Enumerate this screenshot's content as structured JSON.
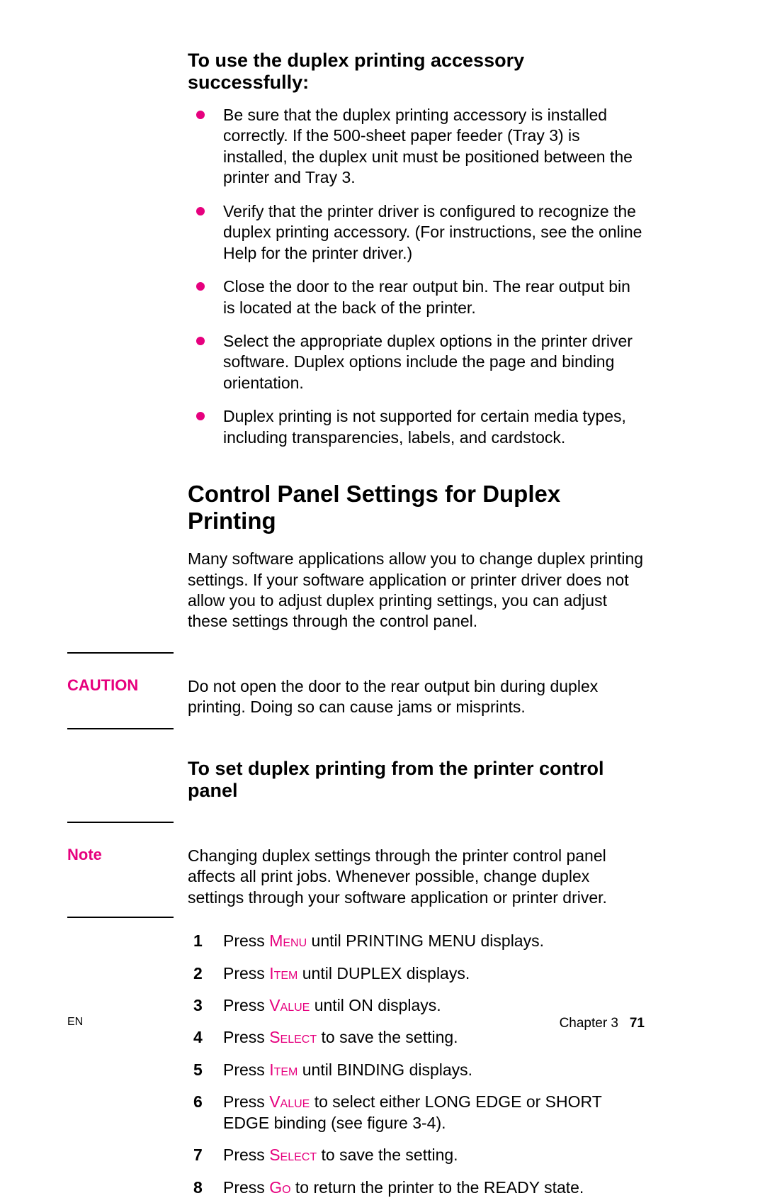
{
  "section1": {
    "heading": "To use the duplex printing accessory successfully:",
    "bullets": [
      "Be sure that the duplex printing accessory is installed correctly. If the 500-sheet paper feeder (Tray 3) is installed, the duplex unit must be positioned between the printer and Tray 3.",
      "Verify that the printer driver is configured to recognize the duplex printing accessory. (For instructions, see the online Help for the printer driver.)",
      "Close the door to the rear output bin. The rear output bin is located at the back of the printer.",
      "Select the appropriate duplex options in the printer driver software. Duplex options include the page and binding orientation.",
      "Duplex printing is not supported for certain media types, including transparencies, labels, and cardstock."
    ]
  },
  "section2": {
    "heading": "Control Panel Settings for Duplex Printing",
    "intro": "Many software applications allow you to change duplex printing settings. If your software application or printer driver does not allow you to adjust duplex printing settings, you can adjust these settings through the control panel."
  },
  "caution": {
    "label": "CAUTION",
    "text": "Do not open the door to the rear output bin during duplex printing. Doing so can cause jams or misprints."
  },
  "section3": {
    "heading": "To set duplex printing from the printer control panel"
  },
  "note": {
    "label": "Note",
    "text": "Changing duplex settings through the printer control panel affects all print jobs. Whenever possible, change duplex settings through your software application or printer driver."
  },
  "steps": {
    "s1_a": "Press ",
    "s1_k": "Menu",
    "s1_b": " until PRINTING MENU displays.",
    "s2_a": "Press ",
    "s2_k": "Item",
    "s2_b": " until DUPLEX displays.",
    "s3_a": "Press ",
    "s3_k": "Value",
    "s3_b": " until ON displays.",
    "s4_a": "Press ",
    "s4_k": "Select",
    "s4_b": " to save the setting.",
    "s5_a": "Press ",
    "s5_k": "Item",
    "s5_b": " until BINDING displays.",
    "s6_a": "Press ",
    "s6_k": "Value",
    "s6_b": " to select either LONG EDGE or SHORT EDGE binding (see figure 3-4).",
    "s7_a": "Press ",
    "s7_k": "Select",
    "s7_b": " to save the setting.",
    "s8_a": "Press ",
    "s8_k": "Go",
    "s8_b": " to return the printer to the READY state."
  },
  "step_nums": {
    "n1": "1",
    "n2": "2",
    "n3": "3",
    "n4": "4",
    "n5": "5",
    "n6": "6",
    "n7": "7",
    "n8": "8"
  },
  "footer": {
    "left": "EN",
    "chapter": "Chapter 3",
    "page": "71"
  }
}
